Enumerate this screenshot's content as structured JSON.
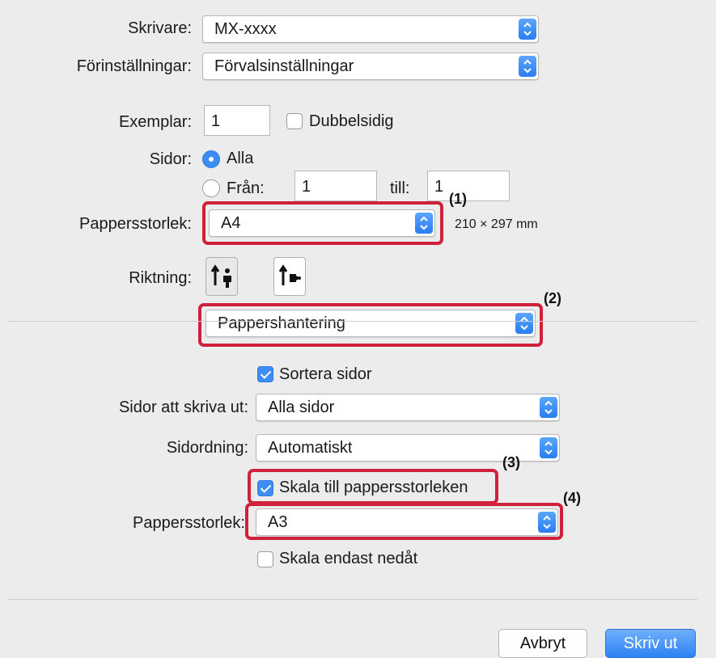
{
  "printer": {
    "label": "Skrivare:",
    "value": "MX-xxxx"
  },
  "presets": {
    "label": "Förinställningar:",
    "value": "Förvalsinställningar"
  },
  "copies": {
    "label": "Exemplar:",
    "value": "1",
    "two_sided_label": "Dubbelsidig",
    "two_sided_checked": false
  },
  "pages": {
    "label": "Sidor:",
    "all_label": "Alla",
    "from_label": "Från:",
    "from_value": "1",
    "to_label": "till:",
    "to_value": "1",
    "selected": "all"
  },
  "paper_size": {
    "label": "Pappersstorlek:",
    "value": "A4",
    "dimensions": "210 × 297 mm"
  },
  "orientation": {
    "label": "Riktning:",
    "options": [
      "portrait-icon",
      "landscape-icon"
    ],
    "selected": "portrait-icon"
  },
  "section_popup": {
    "value": "Pappershantering"
  },
  "collate": {
    "label": "Sortera sidor",
    "checked": true
  },
  "pages_to_print": {
    "label": "Sidor att skriva ut:",
    "value": "Alla sidor"
  },
  "page_order": {
    "label": "Sidordning:",
    "value": "Automatiskt"
  },
  "scale_to_fit": {
    "label": "Skala till pappersstorleken",
    "checked": true
  },
  "destination_paper": {
    "label": "Pappersstorlek:",
    "value": "A3"
  },
  "scale_down_only": {
    "label": "Skala endast nedåt",
    "checked": false
  },
  "callouts": [
    "(1)",
    "(2)",
    "(3)",
    "(4)"
  ],
  "buttons": {
    "cancel": "Avbryt",
    "print": "Skriv ut"
  },
  "colors": {
    "accent": "#3d8df5",
    "highlight": "#d0213a",
    "background": "#ececec"
  }
}
